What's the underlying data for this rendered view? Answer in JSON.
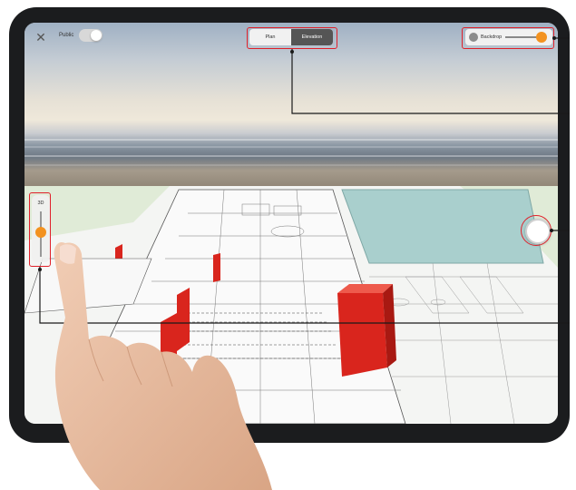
{
  "app": {
    "public_label": "Public",
    "public_toggle_on": false
  },
  "view_toggle": {
    "options": [
      "Plan",
      "Elevation"
    ],
    "selected": "Elevation"
  },
  "backdrop": {
    "label": "Backdrop",
    "slider_level": 1.0
  },
  "dimension_slider": {
    "label": "3D",
    "level": 0.45
  },
  "colors": {
    "accent_orange": "#f39220",
    "callout_red": "#e0202a",
    "pool_blue": "#a9cfcd",
    "wall_red": "#d9251d"
  },
  "icons": [
    "close-icon",
    "orbit-icon"
  ]
}
